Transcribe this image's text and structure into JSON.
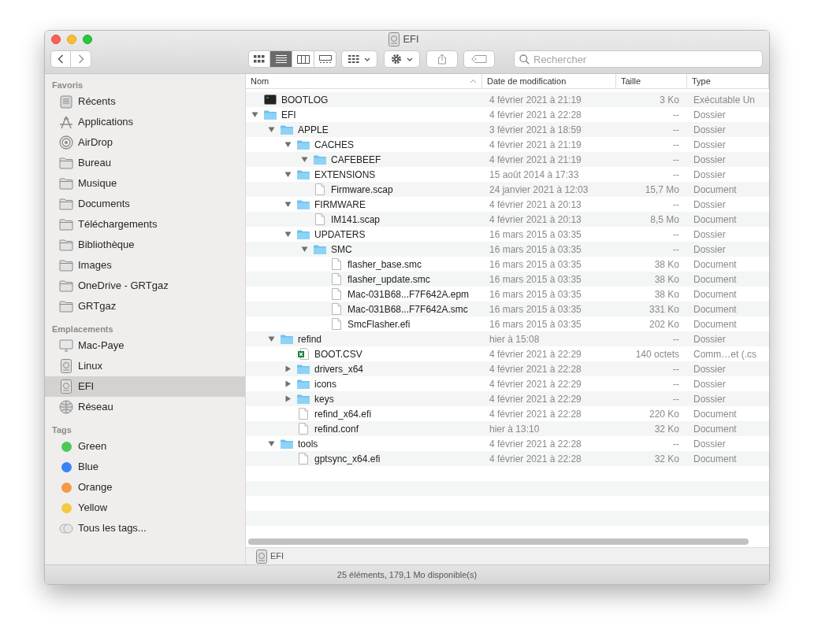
{
  "window": {
    "title": "EFI"
  },
  "toolbar": {
    "view_modes": [
      {
        "kind": "icons",
        "selected": false
      },
      {
        "kind": "list",
        "selected": true
      },
      {
        "kind": "columns",
        "selected": false
      },
      {
        "kind": "gallery",
        "selected": false
      }
    ],
    "search": {
      "placeholder": "Rechercher"
    }
  },
  "sidebar": {
    "sections": [
      {
        "title": "Favoris",
        "items": [
          {
            "label": "Récents",
            "kind": "recents",
            "selected": false
          },
          {
            "label": "Applications",
            "kind": "apps",
            "selected": false
          },
          {
            "label": "AirDrop",
            "kind": "airdrop",
            "selected": false
          },
          {
            "label": "Bureau",
            "kind": "folder",
            "selected": false
          },
          {
            "label": "Musique",
            "kind": "folder",
            "selected": false
          },
          {
            "label": "Documents",
            "kind": "folder",
            "selected": false
          },
          {
            "label": "Téléchargements",
            "kind": "folder",
            "selected": false
          },
          {
            "label": "Bibliothèque",
            "kind": "folder",
            "selected": false
          },
          {
            "label": "Images",
            "kind": "folder",
            "selected": false
          },
          {
            "label": "OneDrive - GRTgaz",
            "kind": "folder",
            "selected": false
          },
          {
            "label": "GRTgaz",
            "kind": "folder",
            "selected": false
          }
        ]
      },
      {
        "title": "Emplacements",
        "items": [
          {
            "label": "Mac-Paye",
            "kind": "computer",
            "selected": false
          },
          {
            "label": "Linux",
            "kind": "disk",
            "selected": false
          },
          {
            "label": "EFI",
            "kind": "disk",
            "selected": true
          },
          {
            "label": "Réseau",
            "kind": "network",
            "selected": false
          }
        ]
      },
      {
        "title": "Tags",
        "items": [
          {
            "label": "Green",
            "kind": "tag",
            "color": "#4cc955",
            "selected": false
          },
          {
            "label": "Blue",
            "kind": "tag",
            "color": "#3b82f6",
            "selected": false
          },
          {
            "label": "Orange",
            "kind": "tag",
            "color": "#f59a42",
            "selected": false
          },
          {
            "label": "Yellow",
            "kind": "tag",
            "color": "#f5c842",
            "selected": false
          },
          {
            "label": "Tous les tags...",
            "kind": "all_tags",
            "selected": false
          }
        ]
      }
    ]
  },
  "table": {
    "columns": [
      {
        "label": "Nom",
        "sorted": true
      },
      {
        "label": "Date de modification",
        "sorted": false
      },
      {
        "label": "Taille",
        "sorted": false
      },
      {
        "label": "Type",
        "sorted": false
      }
    ],
    "rows": [
      {
        "name": "BOOTLOG",
        "kind": "executable",
        "date": "4 février 2021 à 21:19",
        "size": "3 Ko",
        "type": "Exécutable Un"
      },
      {
        "name": "EFI",
        "kind": "folder",
        "expanded": true,
        "date": "4 février 2021 à 22:28",
        "size": "--",
        "type": "Dossier",
        "children": [
          {
            "name": "APPLE",
            "kind": "folder",
            "expanded": true,
            "date": "3 février 2021 à 18:59",
            "size": "--",
            "type": "Dossier",
            "children": [
              {
                "name": "CACHES",
                "kind": "folder",
                "expanded": true,
                "date": "4 février 2021 à 21:19",
                "size": "--",
                "type": "Dossier",
                "children": [
                  {
                    "name": "CAFEBEEF",
                    "kind": "folder",
                    "expanded": true,
                    "date": "4 février 2021 à 21:19",
                    "size": "--",
                    "type": "Dossier"
                  }
                ]
              },
              {
                "name": "EXTENSIONS",
                "kind": "folder",
                "expanded": true,
                "date": "15 août 2014 à 17:33",
                "size": "--",
                "type": "Dossier",
                "children": [
                  {
                    "name": "Firmware.scap",
                    "kind": "document",
                    "date": "24 janvier 2021 à 12:03",
                    "size": "15,7 Mo",
                    "type": "Document"
                  }
                ]
              },
              {
                "name": "FIRMWARE",
                "kind": "folder",
                "expanded": true,
                "date": "4 février 2021 à 20:13",
                "size": "--",
                "type": "Dossier",
                "children": [
                  {
                    "name": "IM141.scap",
                    "kind": "document",
                    "date": "4 février 2021 à 20:13",
                    "size": "8,5 Mo",
                    "type": "Document"
                  }
                ]
              },
              {
                "name": "UPDATERS",
                "kind": "folder",
                "expanded": true,
                "date": "16 mars 2015 à 03:35",
                "size": "--",
                "type": "Dossier",
                "children": [
                  {
                    "name": "SMC",
                    "kind": "folder",
                    "expanded": true,
                    "date": "16 mars 2015 à 03:35",
                    "size": "--",
                    "type": "Dossier",
                    "children": [
                      {
                        "name": "flasher_base.smc",
                        "kind": "document",
                        "date": "16 mars 2015 à 03:35",
                        "size": "38 Ko",
                        "type": "Document"
                      },
                      {
                        "name": "flasher_update.smc",
                        "kind": "document",
                        "date": "16 mars 2015 à 03:35",
                        "size": "38 Ko",
                        "type": "Document"
                      },
                      {
                        "name": "Mac-031B68...F7F642A.epm",
                        "kind": "document",
                        "date": "16 mars 2015 à 03:35",
                        "size": "38 Ko",
                        "type": "Document"
                      },
                      {
                        "name": "Mac-031B68...F7F642A.smc",
                        "kind": "document",
                        "date": "16 mars 2015 à 03:35",
                        "size": "331 Ko",
                        "type": "Document"
                      },
                      {
                        "name": "SmcFlasher.efi",
                        "kind": "document",
                        "date": "16 mars 2015 à 03:35",
                        "size": "202 Ko",
                        "type": "Document"
                      }
                    ]
                  }
                ]
              }
            ]
          },
          {
            "name": "refind",
            "kind": "folder",
            "expanded": true,
            "date": "hier à 15:08",
            "size": "--",
            "type": "Dossier",
            "children": [
              {
                "name": "BOOT.CSV",
                "kind": "spreadsheet",
                "date": "4 février 2021 à 22:29",
                "size": "140 octets",
                "type": "Comm…et (.cs"
              },
              {
                "name": "drivers_x64",
                "kind": "folder",
                "expanded": false,
                "date": "4 février 2021 à 22:28",
                "size": "--",
                "type": "Dossier"
              },
              {
                "name": "icons",
                "kind": "folder",
                "expanded": false,
                "date": "4 février 2021 à 22:29",
                "size": "--",
                "type": "Dossier"
              },
              {
                "name": "keys",
                "kind": "folder",
                "expanded": false,
                "date": "4 février 2021 à 22:29",
                "size": "--",
                "type": "Dossier"
              },
              {
                "name": "refind_x64.efi",
                "kind": "document",
                "date": "4 février 2021 à 22:28",
                "size": "220 Ko",
                "type": "Document"
              },
              {
                "name": "refind.conf",
                "kind": "document",
                "date": "hier à 13:10",
                "size": "32 Ko",
                "type": "Document"
              }
            ]
          },
          {
            "name": "tools",
            "kind": "folder",
            "expanded": true,
            "date": "4 février 2021 à 22:28",
            "size": "--",
            "type": "Dossier",
            "children": [
              {
                "name": "gptsync_x64.efi",
                "kind": "document",
                "date": "4 février 2021 à 22:28",
                "size": "32 Ko",
                "type": "Document"
              }
            ]
          }
        ]
      }
    ]
  },
  "path_bar": {
    "label": "EFI"
  },
  "status_bar": "25 éléments, 179,1 Mo disponible(s)"
}
